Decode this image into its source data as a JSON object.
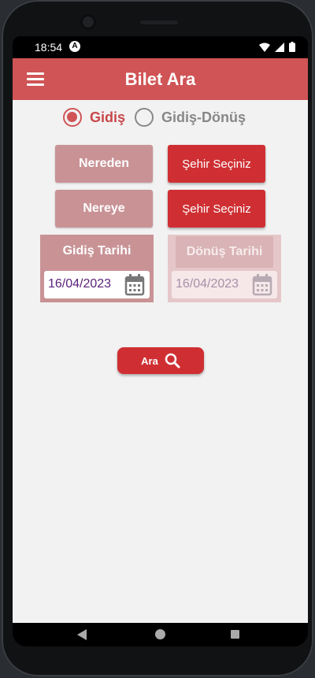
{
  "status": {
    "time": "18:54",
    "app_badge": "A"
  },
  "app": {
    "title": "Bilet Ara"
  },
  "trip_type": {
    "one_way_label": "Gidiş",
    "round_trip_label": "Gidiş-Dönüş",
    "selected": "one_way"
  },
  "from": {
    "label": "Nereden",
    "value": "Şehir Seçiniz"
  },
  "to": {
    "label": "Nereye",
    "value": "Şehir Seçiniz"
  },
  "departure": {
    "label": "Gidiş Tarihi",
    "date": "16/04/2023"
  },
  "return": {
    "label": "Dönüş Tarihi",
    "date": "16/04/2023",
    "enabled": false
  },
  "search": {
    "label": "Ara"
  },
  "colors": {
    "appbar": "#d05456",
    "primary_button": "#cf2f33",
    "label_button": "#c99396",
    "date_text": "#5a1f7a"
  }
}
